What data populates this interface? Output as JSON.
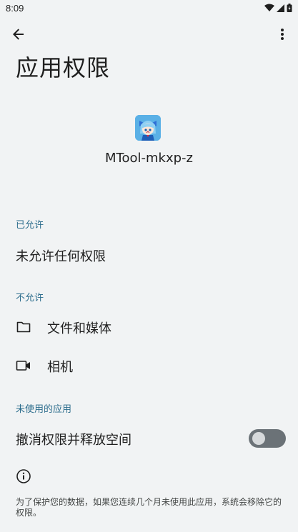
{
  "status_bar": {
    "time": "8:09"
  },
  "app_bar": {
    "back_icon": "arrow-back-icon",
    "more_icon": "more-vert-icon"
  },
  "page": {
    "title": "应用权限"
  },
  "app": {
    "name": "MTool-mkxp-z",
    "icon": "app-icon"
  },
  "sections": {
    "allowed": {
      "label": "已允许",
      "empty_text": "未允许任何权限"
    },
    "not_allowed": {
      "label": "不允许",
      "items": [
        {
          "label": "文件和媒体",
          "icon": "folder-icon"
        },
        {
          "label": "相机",
          "icon": "camera-icon"
        }
      ]
    },
    "unused": {
      "label": "未使用的应用",
      "toggle_label": "撤消权限并释放空间",
      "toggle_on": false,
      "info_icon": "info-icon",
      "footer": "为了保护您的数据，如果您连续几个月未使用此应用，系统会移除它的权限。"
    }
  },
  "colors": {
    "accent": "#2b6c8c",
    "background": "#f1f3f4",
    "toggle_off": "#6b7277"
  }
}
